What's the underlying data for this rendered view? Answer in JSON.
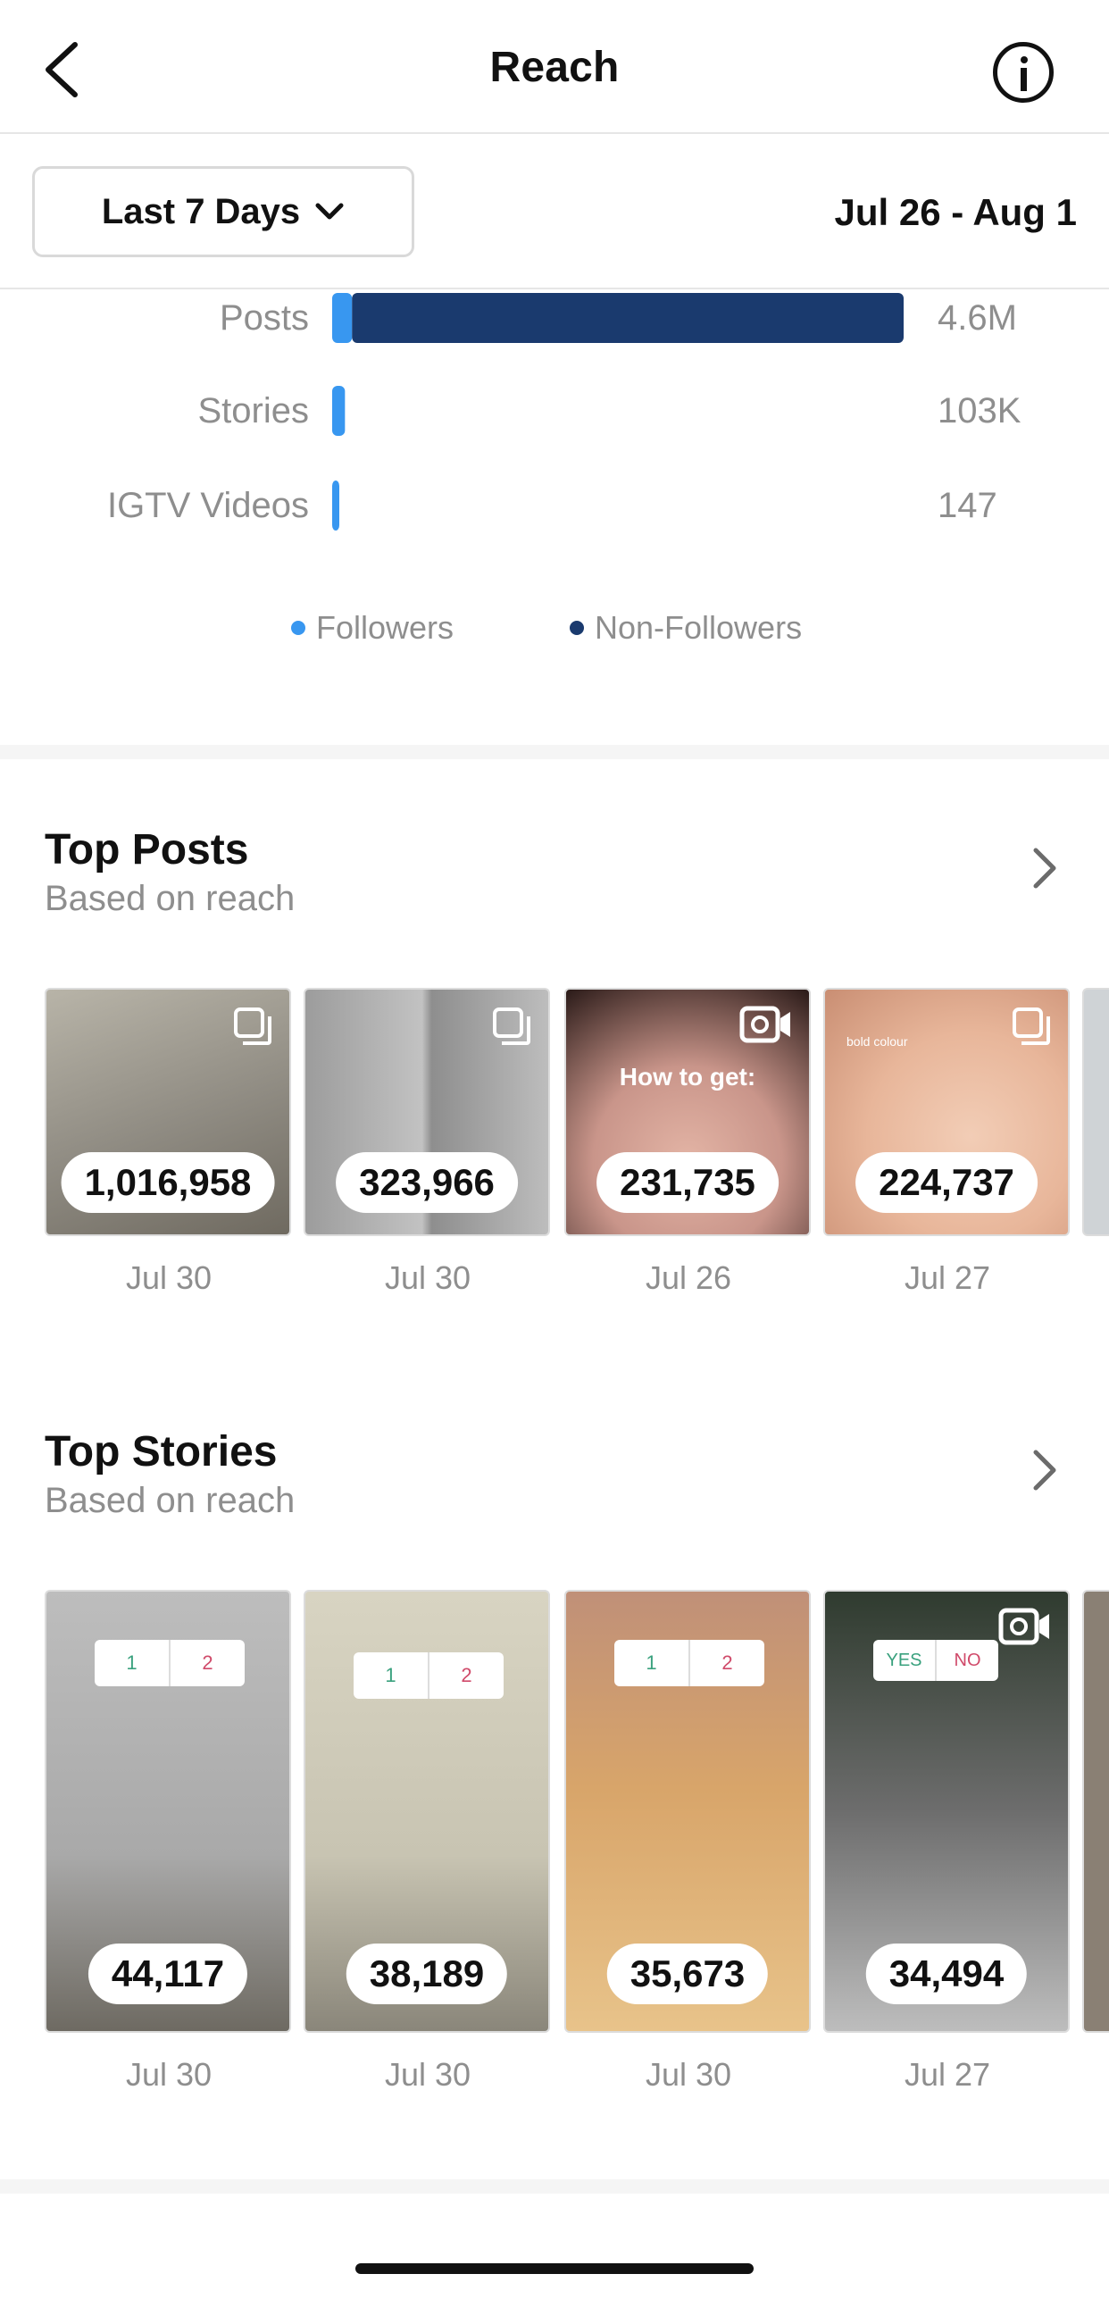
{
  "header": {
    "title": "Reach",
    "back_icon": "chevron-left-icon",
    "info_icon": "info-circle-icon"
  },
  "filter": {
    "range_label": "Last 7 Days",
    "range_icon": "chevron-down-icon",
    "date_range": "Jul 26 - Aug 1"
  },
  "chart_data": {
    "type": "bar",
    "orientation": "horizontal",
    "stacked": true,
    "categories": [
      "Posts",
      "Stories",
      "IGTV Videos"
    ],
    "value_labels": [
      "4.6M",
      "103K",
      "147"
    ],
    "series": [
      {
        "name": "Followers",
        "color": "#3897f0",
        "values": [
          0.16,
          0.103,
          0.0001
        ]
      },
      {
        "name": "Non-Followers",
        "color": "#1a3a6e",
        "values": [
          4.44,
          0,
          0
        ]
      }
    ],
    "unit": "millions",
    "xlim": [
      0,
      4.6
    ],
    "grid": false,
    "legend_position": "bottom"
  },
  "top_posts": {
    "title": "Top Posts",
    "subtitle": "Based on reach",
    "arrow_icon": "chevron-right-icon",
    "items": [
      {
        "count": "1,016,958",
        "date": "Jul 30",
        "badge_icon": "carousel-icon",
        "bg": "#8f8b82"
      },
      {
        "count": "323,966",
        "date": "Jul 30",
        "badge_icon": "carousel-icon",
        "bg": "#9a9a9a"
      },
      {
        "count": "231,735",
        "date": "Jul 26",
        "badge_icon": "video-icon",
        "bg": "#c9958a",
        "overlay_text": "How to get:"
      },
      {
        "count": "224,737",
        "date": "Jul 27",
        "badge_icon": "carousel-icon",
        "bg": "#e8b69a",
        "overlay_text": "bold colour"
      }
    ]
  },
  "top_stories": {
    "title": "Top Stories",
    "subtitle": "Based on reach",
    "arrow_icon": "chevron-right-icon",
    "items": [
      {
        "count": "44,117",
        "date": "Jul 30",
        "poll": [
          "1",
          "2"
        ],
        "bg": "#a9a9a9"
      },
      {
        "count": "38,189",
        "date": "Jul 30",
        "poll": [
          "1",
          "2"
        ],
        "bg": "#c8c4b2"
      },
      {
        "count": "35,673",
        "date": "Jul 30",
        "poll": [
          "1",
          "2"
        ],
        "bg": "#d8a56a"
      },
      {
        "count": "34,494",
        "date": "Jul 27",
        "poll": [
          "YES",
          "NO"
        ],
        "bg": "#6d6d6d",
        "badge_icon": "video-icon"
      }
    ]
  }
}
